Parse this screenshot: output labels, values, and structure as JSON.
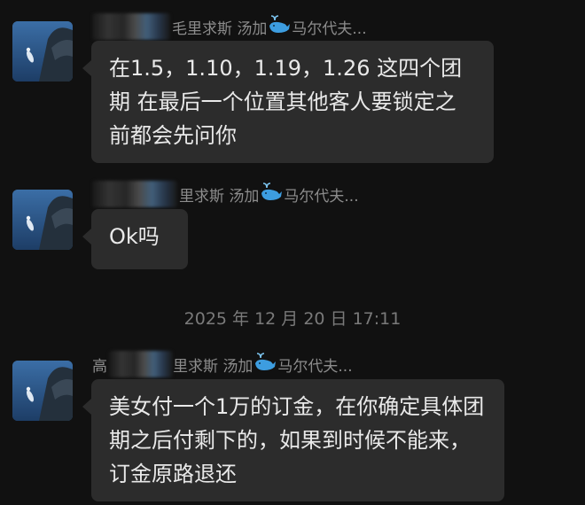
{
  "messages": [
    {
      "sender_prefix": "",
      "sender_name": "毛里求斯 汤加",
      "sender_suffix": "马尔代夫...",
      "text": "在1.5，1.10，1.19，1.26 这四个团期 在最后一个位置其他客人要锁定之前都会先问你"
    },
    {
      "sender_prefix": "",
      "sender_name": "里求斯 汤加",
      "sender_suffix": "马尔代夫...",
      "text": "Ok吗"
    },
    {
      "sender_prefix": "高",
      "sender_name": "里求斯 汤加",
      "sender_suffix": "马尔代夫...",
      "text": "美女付一个1万的订金，在你确定具体团期之后付剩下的，如果到时候不能来，订金原路退还"
    }
  ],
  "timestamp": "2025 年 12 月 20 日  17:11",
  "icons": {
    "whale": "spouting-whale-icon",
    "avatar": "underwater-whale-photo"
  },
  "colors": {
    "background": "#111111",
    "bubble": "#2c2c2c",
    "text": "#e9e9e9",
    "meta": "#8c8c8c"
  }
}
